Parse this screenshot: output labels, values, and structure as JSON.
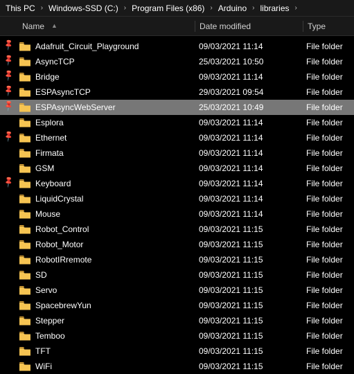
{
  "breadcrumb": {
    "segments": [
      "This PC",
      "Windows-SSD (C:)",
      "Program Files (x86)",
      "Arduino",
      "libraries"
    ]
  },
  "columns": {
    "name": "Name",
    "date": "Date modified",
    "type": "Type"
  },
  "pin_rows": [
    0,
    1,
    2,
    3,
    4,
    6,
    9
  ],
  "rows": [
    {
      "name": "Adafruit_Circuit_Playground",
      "date": "09/03/2021 11:14",
      "type": "File folder",
      "selected": false
    },
    {
      "name": "AsyncTCP",
      "date": "25/03/2021 10:50",
      "type": "File folder",
      "selected": false
    },
    {
      "name": "Bridge",
      "date": "09/03/2021 11:14",
      "type": "File folder",
      "selected": false
    },
    {
      "name": "ESPAsyncTCP",
      "date": "29/03/2021 09:54",
      "type": "File folder",
      "selected": false
    },
    {
      "name": "ESPAsyncWebServer",
      "date": "25/03/2021 10:49",
      "type": "File folder",
      "selected": true
    },
    {
      "name": "Esplora",
      "date": "09/03/2021 11:14",
      "type": "File folder",
      "selected": false
    },
    {
      "name": "Ethernet",
      "date": "09/03/2021 11:14",
      "type": "File folder",
      "selected": false
    },
    {
      "name": "Firmata",
      "date": "09/03/2021 11:14",
      "type": "File folder",
      "selected": false
    },
    {
      "name": "GSM",
      "date": "09/03/2021 11:14",
      "type": "File folder",
      "selected": false
    },
    {
      "name": "Keyboard",
      "date": "09/03/2021 11:14",
      "type": "File folder",
      "selected": false
    },
    {
      "name": "LiquidCrystal",
      "date": "09/03/2021 11:14",
      "type": "File folder",
      "selected": false
    },
    {
      "name": "Mouse",
      "date": "09/03/2021 11:14",
      "type": "File folder",
      "selected": false
    },
    {
      "name": "Robot_Control",
      "date": "09/03/2021 11:15",
      "type": "File folder",
      "selected": false
    },
    {
      "name": "Robot_Motor",
      "date": "09/03/2021 11:15",
      "type": "File folder",
      "selected": false
    },
    {
      "name": "RobotIRremote",
      "date": "09/03/2021 11:15",
      "type": "File folder",
      "selected": false
    },
    {
      "name": "SD",
      "date": "09/03/2021 11:15",
      "type": "File folder",
      "selected": false
    },
    {
      "name": "Servo",
      "date": "09/03/2021 11:15",
      "type": "File folder",
      "selected": false
    },
    {
      "name": "SpacebrewYun",
      "date": "09/03/2021 11:15",
      "type": "File folder",
      "selected": false
    },
    {
      "name": "Stepper",
      "date": "09/03/2021 11:15",
      "type": "File folder",
      "selected": false
    },
    {
      "name": "Temboo",
      "date": "09/03/2021 11:15",
      "type": "File folder",
      "selected": false
    },
    {
      "name": "TFT",
      "date": "09/03/2021 11:15",
      "type": "File folder",
      "selected": false
    },
    {
      "name": "WiFi",
      "date": "09/03/2021 11:15",
      "type": "File folder",
      "selected": false
    }
  ]
}
